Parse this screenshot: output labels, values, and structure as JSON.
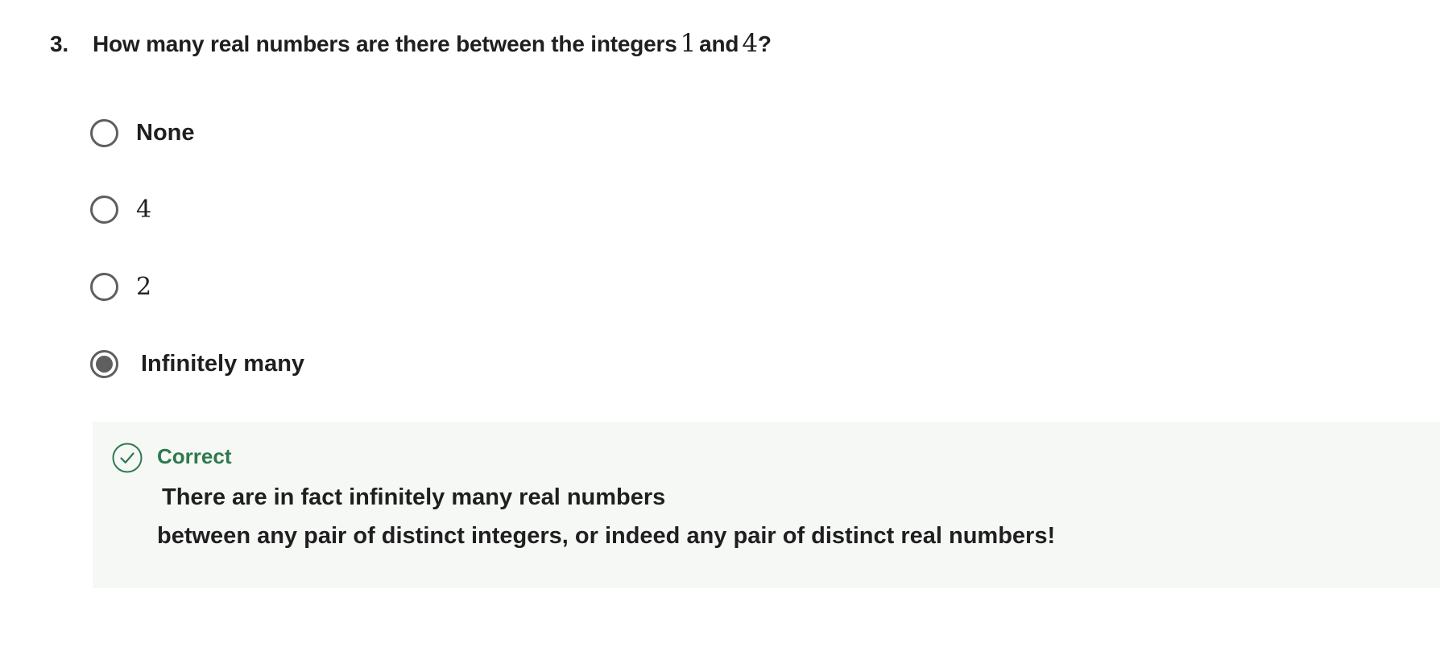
{
  "question": {
    "number": "3.",
    "text_before": "How many real numbers are there between the integers",
    "math_a": "1",
    "text_middle": "and",
    "math_b": "4",
    "text_after": "?"
  },
  "options": [
    {
      "label": "None",
      "selected": false
    },
    {
      "label": "4",
      "selected": false,
      "math": true
    },
    {
      "label": "2",
      "selected": false,
      "math": true
    },
    {
      "label": "Infinitely many",
      "selected": true
    }
  ],
  "feedback": {
    "status": "Correct",
    "status_color": "#2d7a4d",
    "icon": "check-circle-icon",
    "line1": "There are in fact infinitely many real numbers",
    "line2": "between any pair of distinct integers, or indeed any pair of distinct real numbers!"
  }
}
